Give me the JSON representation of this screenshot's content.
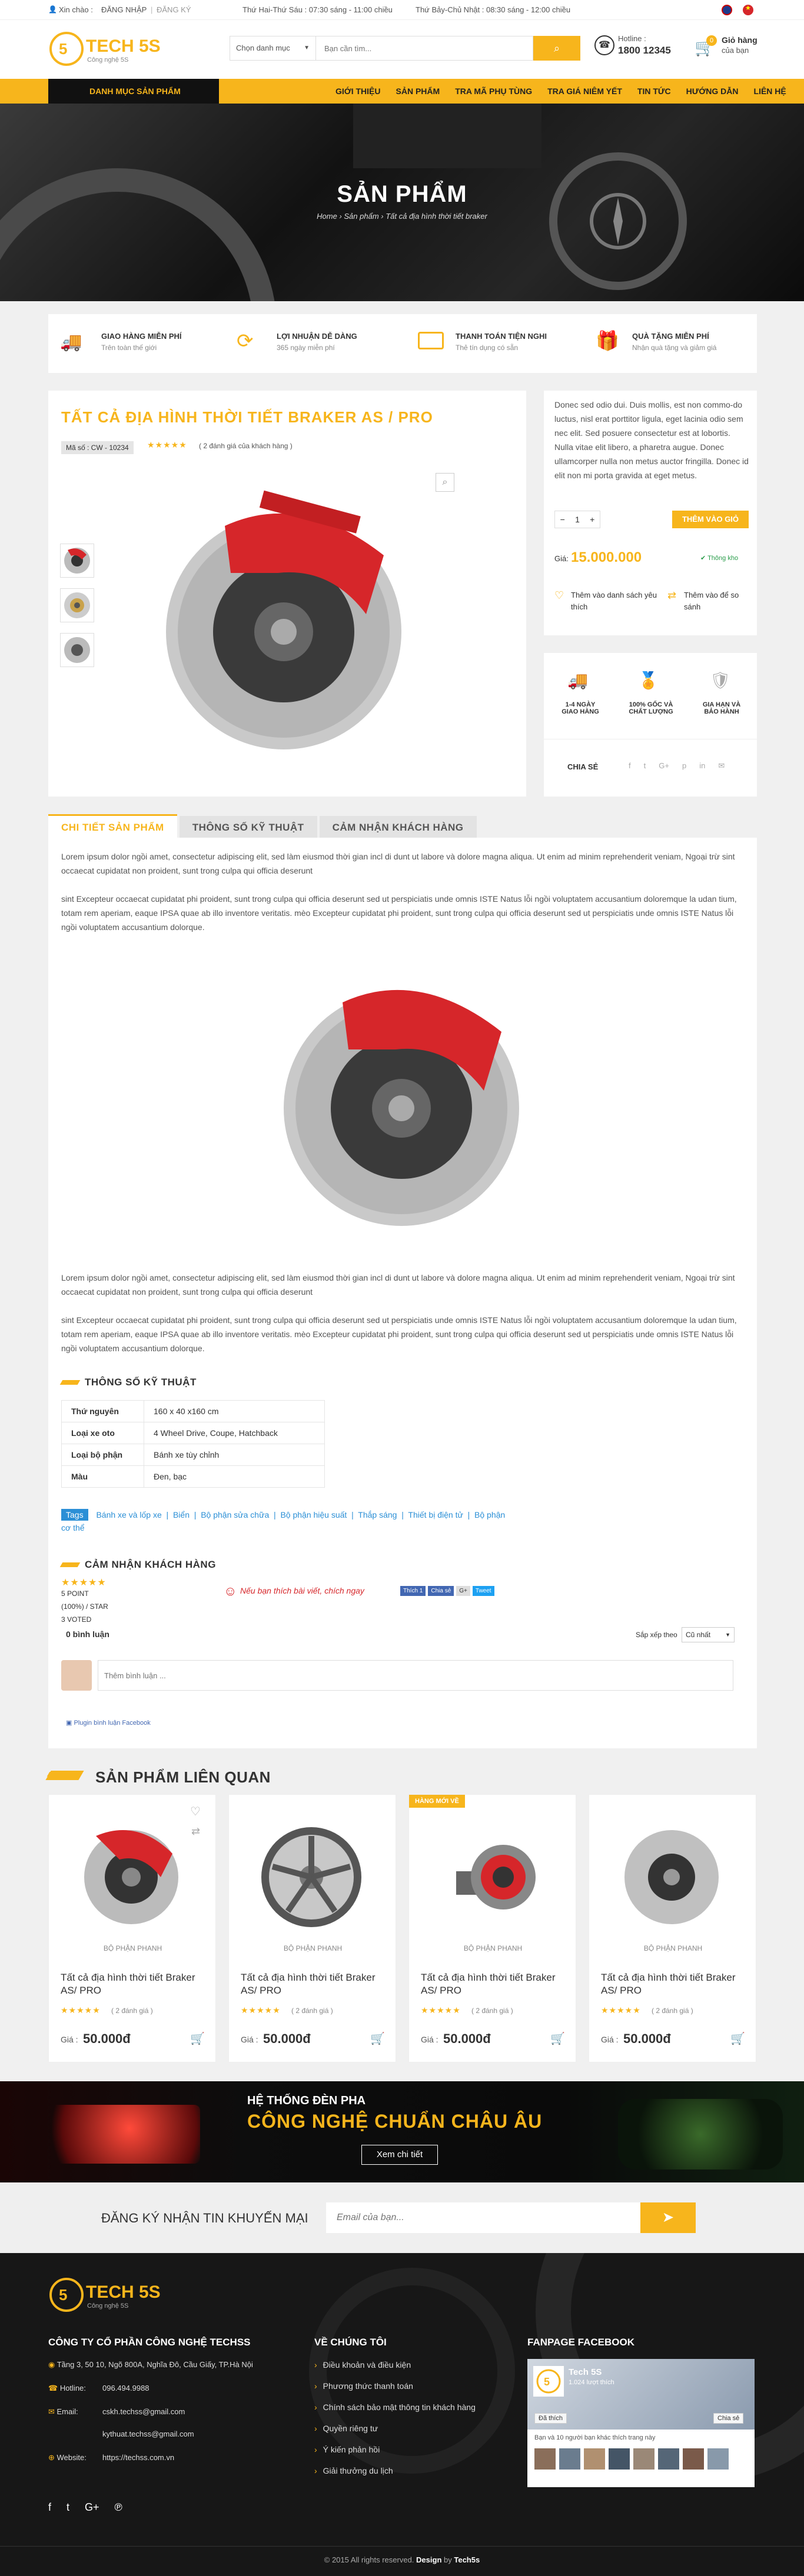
{
  "topbar": {
    "greeting": "Xin chào :",
    "login": "ĐĂNG NHẬP",
    "register": "ĐĂNG KÝ",
    "hours_weekday": "Thứ Hai-Thứ Sáu : 07:30 sáng - 11:00 chiều",
    "hours_weekend": "Thứ Bảy-Chủ Nhật : 08:30 sáng - 12:00 chiều"
  },
  "header": {
    "logo_text": "TECH 5S",
    "logo_sub": "Công nghệ 5S",
    "category_select": "Chọn danh mục",
    "search_placeholder": "Bạn cần tìm...",
    "hotline_label": "Hotline :",
    "hotline_number": "1800 12345",
    "cart_count": "0",
    "cart_label": "Giỏ hàng",
    "cart_sub": "của bạn"
  },
  "nav": {
    "category_button": "DANH MỤC SẢN PHẨM",
    "items": [
      "GIỚI THIỆU",
      "SẢN PHẨM",
      "TRA MÃ PHỤ TÙNG",
      "TRA GIÁ NIÊM YẾT",
      "TIN TỨC",
      "HƯỚNG DẪN",
      "LIÊN HỆ"
    ]
  },
  "hero": {
    "title": "SẢN PHẨM",
    "crumb_home": "Home",
    "crumb_products": "Sản phẩm",
    "crumb_current": "Tất cả địa hình thời tiết braker"
  },
  "features": [
    {
      "icon": "truck-icon",
      "title": "GIAO HÀNG MIỄN PHÍ",
      "sub": "Trên toàn thế giới"
    },
    {
      "icon": "refresh-icon",
      "title": "LỢI NHUẬN DỄ DÀNG",
      "sub": "365 ngày miễn phí"
    },
    {
      "icon": "wallet-icon",
      "title": "THANH TOÁN TIỆN NGHI",
      "sub": "Thẻ tín dụng có sẵn"
    },
    {
      "icon": "gift-icon",
      "title": "QUÀ TẶNG MIỄN PHÍ",
      "sub": "Nhận quà tặng và giảm giá"
    }
  ],
  "product": {
    "title": "TẤT CẢ ĐỊA HÌNH THỜI TIẾT BRAKER AS / PRO",
    "sku": "Mã số : CW - 10234",
    "rating_text": "( 2 đánh giá của khách hàng )",
    "desc": "Donec sed odio dui. Duis mollis, est non commo-do luctus, nisl erat porttitor ligula, eget lacinia odio sem nec elit. Sed posuere consectetur est at lobortis.\nNulla vitae elit libero, a pharetra augue. Donec ullamcorper nulla non metus auctor fringilla. Donec id elit non mi porta gravida at eget metus.",
    "qty": "1",
    "add_to_cart": "THÊM VÀO GIỎ HÀNG",
    "price_label": "Giá:",
    "price": "15.000.000",
    "stock": "Thông kho",
    "wishlist": "Thêm vào danh sách yêu thích",
    "compare": "Thêm vào để so sánh",
    "badges": [
      {
        "icon": "truck-icon",
        "text": "1-4 NGÀY GIAO HÀNG"
      },
      {
        "icon": "medal-icon",
        "text": "100% GỐC VÀ CHẤT LƯỢNG"
      },
      {
        "icon": "shield-icon",
        "text": "GIA HẠN VÀ BẢO HÀNH"
      }
    ],
    "share": "CHIA SẺ"
  },
  "tabs": [
    "CHI TIẾT SẢN PHẨM",
    "THÔNG SỐ KỸ THUẬT",
    "CẢM NHẬN KHÁCH HÀNG"
  ],
  "detail": {
    "p1": "Lorem ipsum dolor ngồi amet, consectetur adipiscing elit, sed làm eiusmod thời gian incl di dunt ut labore và dolore magna aliqua. Ut enim ad minim reprehenderit veniam, Ngoại trừ sint occaecat cupidatat non proident, sunt trong culpa qui officia deserunt",
    "p2": "sint Excepteur occaecat cupidatat phi proident, sunt trong culpa qui officia deserunt sed ut perspiciatis unde omnis ISTE Natus lỗi ngồi voluptatem accusantium doloremque la udan tium, totam rem aperiam, eaque IPSA quae ab illo inventore veritatis. mèo Excepteur cupidatat phi proident, sunt trong culpa qui officia deserunt sed ut perspiciatis unde omnis ISTE Natus lỗi ngồi voluptatem accusantium dolorque."
  },
  "specs": {
    "title": "THÔNG SỐ KỸ THUẬT",
    "rows": [
      [
        "Thứ nguyên",
        "160 x 40 x160 cm"
      ],
      [
        "Loại xe oto",
        "4 Wheel Drive, Coupe, Hatchback"
      ],
      [
        "Loại bộ phận",
        "Bánh xe tùy chỉnh"
      ],
      [
        "Màu",
        "Đen, bạc"
      ]
    ],
    "tags_label": "Tags",
    "tags": [
      "Bánh xe và lốp xe",
      "Biển",
      "Bộ phận sửa chữa",
      "Bộ phận hiệu suất",
      "Thắp sáng",
      "Thiết bị điện tử",
      "Bộ phận cơ thể"
    ]
  },
  "reviews": {
    "title": "CẢM NHẬN KHÁCH HÀNG",
    "points": "5 POINT",
    "percent": "(100%) / STAR",
    "voted": "3 VOTED",
    "promo": "Nếu bạn thích bài viết, chích ngay",
    "count": "0 bình luận",
    "sort_label": "Sắp xếp theo",
    "sort_value": "Cũ nhất",
    "comment_placeholder": "Thêm bình luận ...",
    "plugin": "Plugin bình luận Facebook",
    "like": "Thích 1",
    "share": "Chia sẻ",
    "g": "G+",
    "tweet": "Tweet"
  },
  "related": {
    "title": "SẢN PHẨM LIÊN QUAN",
    "new_badge": "HÀNG MỚI VỀ",
    "items": [
      {
        "cat": "BỘ PHẬN PHANH",
        "name": "Tất cả địa hình thời tiết Braker AS/ PRO",
        "rating": "( 2 đánh giá )",
        "price_label": "Giá :",
        "price": "50.000đ"
      },
      {
        "cat": "BỘ PHẬN PHANH",
        "name": "Tất cả địa hình thời tiết Braker AS/ PRO",
        "rating": "( 2 đánh giá )",
        "price_label": "Giá :",
        "price": "50.000đ"
      },
      {
        "cat": "BỘ PHẬN PHANH",
        "name": "Tất cả địa hình thời tiết Braker AS/ PRO",
        "rating": "( 2 đánh giá )",
        "price_label": "Giá :",
        "price": "50.000đ"
      },
      {
        "cat": "BỘ PHẬN PHANH",
        "name": "Tất cả địa hình thời tiết Braker AS/ PRO",
        "rating": "( 2 đánh giá )",
        "price_label": "Giá :",
        "price": "50.000đ"
      }
    ]
  },
  "banner": {
    "line1": "HỆ THỐNG ĐÈN PHA",
    "line2": "CÔNG NGHỆ CHUẨN CHÂU ÂU",
    "button": "Xem chi tiết"
  },
  "newsletter": {
    "label": "ĐĂNG KÝ NHẬN TIN KHUYẾN MẠI",
    "placeholder": "Email của bạn..."
  },
  "footer": {
    "company": "CÔNG TY CỔ PHẦN CÔNG NGHỆ TECHSS",
    "address": "Tầng 3, 50 10, Ngõ 800A, Nghĩa Đô, Cầu Giấy, TP.Hà Nội",
    "hotline_label": "Hotline:",
    "hotline": "096.494.9988",
    "email_label": "Email:",
    "email1": "cskh.techss@gmail.com",
    "email2": "kythuat.techss@gmail.com",
    "website_label": "Website:",
    "website": "https://techss.com.vn",
    "about_title": "VỀ CHÚNG TÔI",
    "about_links": [
      "Điều khoản và điều kiện",
      "Phương thức thanh toán",
      "Chính sách bảo mật thông tin khách hàng",
      "Quyền riêng tư",
      "Ý kiến phản hồi",
      "Giải thưởng du lịch"
    ],
    "fanpage_title": "FANPAGE FACEBOOK",
    "fb_name": "Tech 5S",
    "fb_likes": "1.024 lượt thích",
    "fb_liked": "Đã thích",
    "fb_share": "Chia sẻ",
    "fb_friends": "Bạn và 10 người bạn khác thích trang này",
    "copyright_pre": "© 2015 All rights reserved.",
    "design_label": "Design",
    "design_by": "by",
    "design_name": "Tech5s"
  },
  "colors": {
    "accent": "#f7b51c",
    "red": "#d6262a",
    "dark": "#171717"
  }
}
